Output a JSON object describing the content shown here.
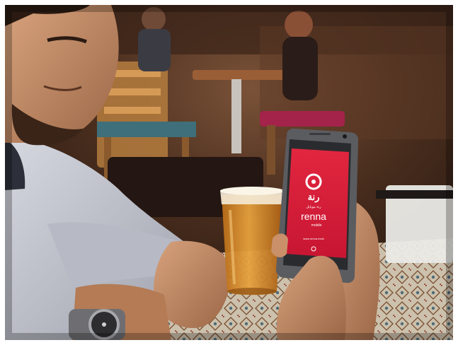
{
  "photo": {
    "screen": {
      "arabic_wordmark": "رنة",
      "arabic_sub": "رنة موبايل",
      "brand": "renna",
      "brand_sub": "mobile",
      "footer_text": "www.renna.mobi"
    },
    "colors": {
      "screen_red": "#d61f3a",
      "phone_body": "#5a5a5c",
      "beer": "#d38a2b",
      "shirt": "#c9cbd3"
    }
  }
}
